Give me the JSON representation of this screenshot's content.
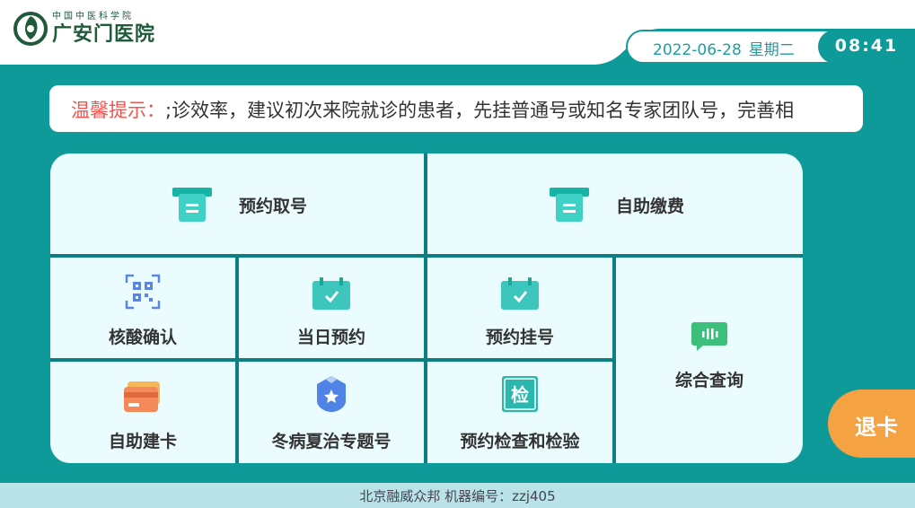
{
  "header": {
    "logo_small": "中国中医科学院",
    "logo_big": "广安门医院",
    "date": "2022-06-28",
    "weekday": "星期二",
    "time": "08:41"
  },
  "notice": {
    "label": "温馨提示：",
    "text": ";诊效率，建议初次来院就诊的患者，先挂普通号或知名专家团队号，完善相"
  },
  "menu": {
    "appointment_pickup": "预约取号",
    "self_payment": "自助缴费",
    "nucleic_confirm": "核酸确认",
    "same_day_appointment": "当日预约",
    "appointment_register": "预约挂号",
    "comprehensive_query": "综合查询",
    "self_card": "自助建卡",
    "winter_disease_summer_treatment": "冬病夏治专题号",
    "exam_appointment": "预约检查和检验"
  },
  "exit_label": "退卡",
  "footer": {
    "text": "北京融威众邦 机器编号：zzj405"
  },
  "colors": {
    "teal": "#0f9a9a",
    "exit_orange": "#f5a342",
    "notice_red": "#f0554f"
  }
}
